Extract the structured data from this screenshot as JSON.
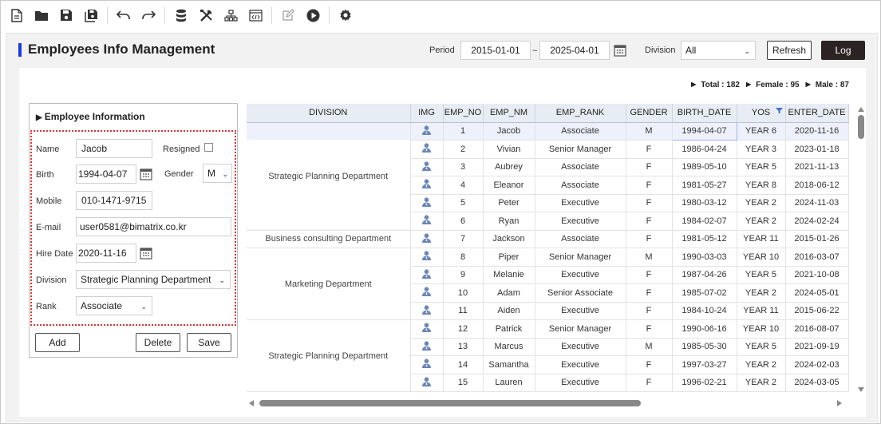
{
  "toolbar": {
    "icons": [
      "new-document-icon",
      "open-folder-icon",
      "save-icon",
      "save-all-icon",
      "undo-icon",
      "redo-icon",
      "database-icon",
      "tools-icon",
      "hierarchy-icon",
      "code-view-icon",
      "edit-icon",
      "run-icon",
      "settings-icon"
    ]
  },
  "header": {
    "title": "Employees Info Management",
    "period_label": "Period",
    "period_from": "2015-01-01",
    "period_sep": "~",
    "period_to": "2025-04-01",
    "division_label": "Division",
    "division_value": "All",
    "refresh_label": "Refresh",
    "log_label": "Log"
  },
  "summary": {
    "total": "Total : 182",
    "female": "Female : 95",
    "male": "Male : 87"
  },
  "form": {
    "title": "Employee Information",
    "name_label": "Name",
    "name_value": "Jacob",
    "resigned_label": "Resigned",
    "birth_label": "Birth",
    "birth_value": "1994-04-07",
    "gender_label": "Gender",
    "gender_value": "M",
    "mobile_label": "Mobile",
    "mobile_value": "010-1471-9715",
    "email_label": "E-mail",
    "email_value": "user0581@bimatrix.co.kr",
    "hire_label": "Hire Date",
    "hire_value": "2020-11-16",
    "division_label": "Division",
    "division_value": "Strategic Planning Department",
    "rank_label": "Rank",
    "rank_value": "Associate",
    "add_label": "Add",
    "delete_label": "Delete",
    "save_label": "Save"
  },
  "grid": {
    "columns": [
      "DIVISION",
      "IMG",
      "EMP_NO",
      "EMP_NM",
      "EMP_RANK",
      "GENDER",
      "BIRTH_DATE",
      "YOS",
      "ENTER_DATE"
    ],
    "division_groups": [
      {
        "label": "Strategic Planning Department",
        "rows": 6
      },
      {
        "label": "Business consulting Department",
        "rows": 1
      },
      {
        "label": "Marketing Department",
        "rows": 4
      },
      {
        "label": "Strategic Planning Department",
        "rows": 4
      }
    ],
    "rows": [
      {
        "no": "1",
        "nm": "Jacob",
        "rank": "Associate",
        "gender": "M",
        "birth": "1994-04-07",
        "yos": "YEAR 6",
        "enter": "2020-11-16"
      },
      {
        "no": "2",
        "nm": "Vivian",
        "rank": "Senior Manager",
        "gender": "F",
        "birth": "1986-04-24",
        "yos": "YEAR 3",
        "enter": "2023-01-18"
      },
      {
        "no": "3",
        "nm": "Aubrey",
        "rank": "Associate",
        "gender": "F",
        "birth": "1989-05-10",
        "yos": "YEAR 5",
        "enter": "2021-11-13"
      },
      {
        "no": "4",
        "nm": "Eleanor",
        "rank": "Associate",
        "gender": "F",
        "birth": "1981-05-27",
        "yos": "YEAR 8",
        "enter": "2018-06-12"
      },
      {
        "no": "5",
        "nm": "Peter",
        "rank": "Executive",
        "gender": "F",
        "birth": "1980-03-12",
        "yos": "YEAR 2",
        "enter": "2024-11-03"
      },
      {
        "no": "6",
        "nm": "Ryan",
        "rank": "Executive",
        "gender": "F",
        "birth": "1984-02-07",
        "yos": "YEAR 2",
        "enter": "2024-02-24"
      },
      {
        "no": "7",
        "nm": "Jackson",
        "rank": "Associate",
        "gender": "F",
        "birth": "1981-05-12",
        "yos": "YEAR 11",
        "enter": "2015-01-26"
      },
      {
        "no": "8",
        "nm": "Piper",
        "rank": "Senior Manager",
        "gender": "M",
        "birth": "1990-03-03",
        "yos": "YEAR 10",
        "enter": "2016-03-07"
      },
      {
        "no": "9",
        "nm": "Melanie",
        "rank": "Executive",
        "gender": "F",
        "birth": "1987-04-26",
        "yos": "YEAR 5",
        "enter": "2021-10-08"
      },
      {
        "no": "10",
        "nm": "Adam",
        "rank": "Senior Associate",
        "gender": "F",
        "birth": "1985-07-02",
        "yos": "YEAR 2",
        "enter": "2024-05-01"
      },
      {
        "no": "11",
        "nm": "Aiden",
        "rank": "Executive",
        "gender": "F",
        "birth": "1984-10-24",
        "yos": "YEAR 11",
        "enter": "2015-06-22"
      },
      {
        "no": "12",
        "nm": "Patrick",
        "rank": "Senior Manager",
        "gender": "F",
        "birth": "1990-06-16",
        "yos": "YEAR 10",
        "enter": "2016-08-07"
      },
      {
        "no": "13",
        "nm": "Marcus",
        "rank": "Executive",
        "gender": "M",
        "birth": "1985-05-30",
        "yos": "YEAR 5",
        "enter": "2021-09-19"
      },
      {
        "no": "14",
        "nm": "Samantha",
        "rank": "Executive",
        "gender": "F",
        "birth": "1997-03-27",
        "yos": "YEAR 2",
        "enter": "2024-02-03"
      },
      {
        "no": "15",
        "nm": "Lauren",
        "rank": "Executive",
        "gender": "F",
        "birth": "1996-02-21",
        "yos": "YEAR 2",
        "enter": "2024-03-05"
      }
    ]
  },
  "colors": {
    "accent": "#1a3adb",
    "log_button": "#2b2323",
    "form_border": "#dd3333",
    "header_bg": "#e8ecf4",
    "avatar": "#6b86b8"
  }
}
